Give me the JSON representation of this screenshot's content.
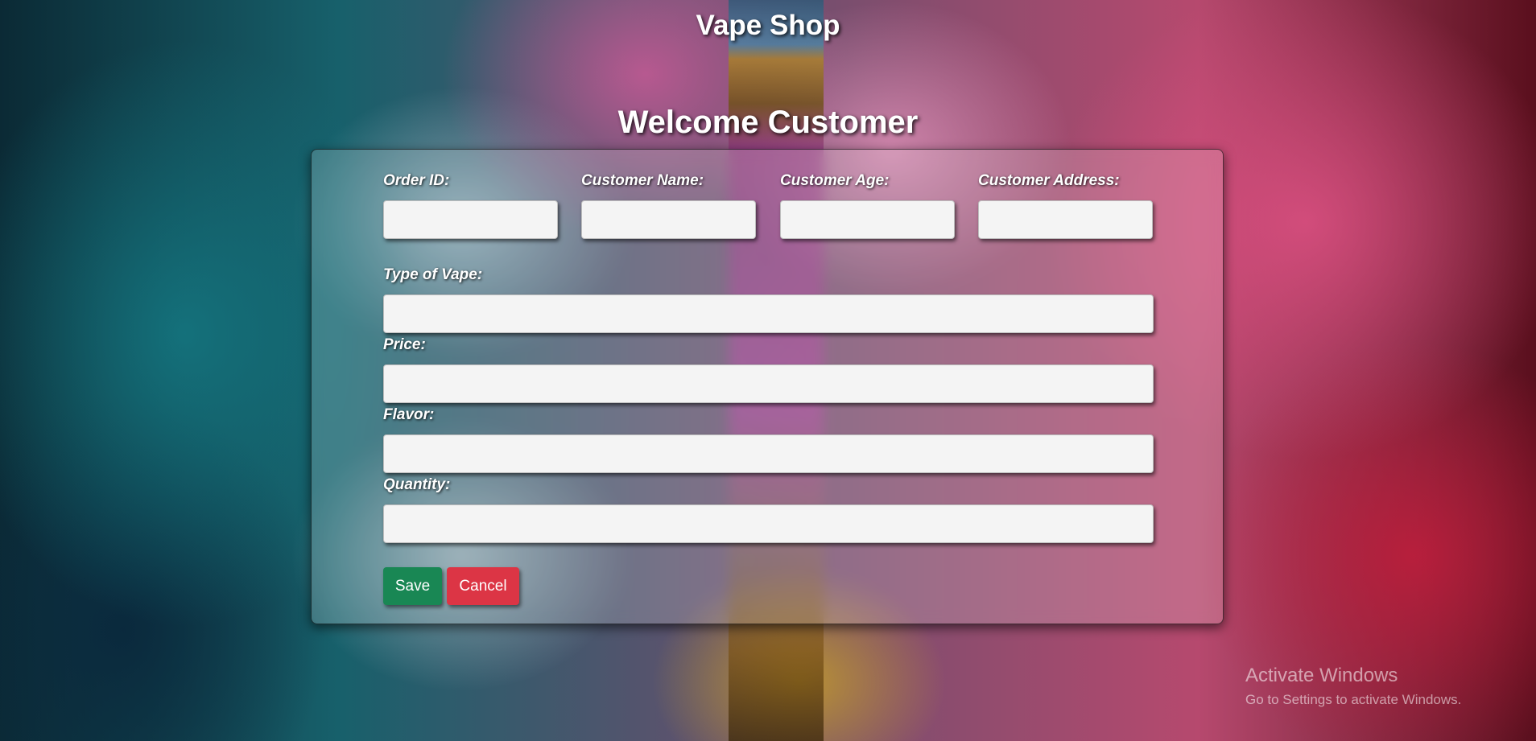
{
  "app": {
    "title": "Vape Shop",
    "heading": "Welcome Customer"
  },
  "form": {
    "order_id": {
      "label": "Order ID:",
      "value": ""
    },
    "customer_name": {
      "label": "Customer Name:",
      "value": ""
    },
    "customer_age": {
      "label": "Customer Age:",
      "value": ""
    },
    "customer_address": {
      "label": "Customer Address:",
      "value": ""
    },
    "type_of_vape": {
      "label": "Type of Vape:",
      "value": ""
    },
    "price": {
      "label": "Price:",
      "value": ""
    },
    "flavor": {
      "label": "Flavor:",
      "value": ""
    },
    "quantity": {
      "label": "Quantity:",
      "value": ""
    }
  },
  "buttons": {
    "save": "Save",
    "cancel": "Cancel"
  },
  "watermark": {
    "title": "Activate Windows",
    "subtitle": "Go to Settings to activate Windows."
  },
  "colors": {
    "save_button": "#198754",
    "cancel_button": "#dc3545",
    "field_background": "#f4f4f4"
  }
}
